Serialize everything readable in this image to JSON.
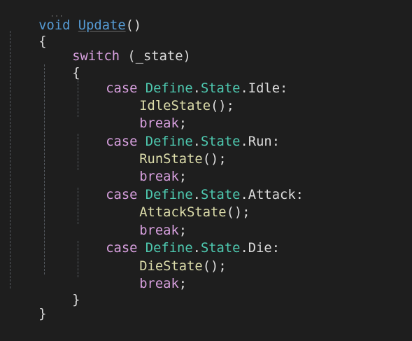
{
  "editor": {
    "lines": [
      [
        {
          "cls": "kw-blue",
          "text": "void"
        },
        {
          "cls": "punct",
          "text": " "
        },
        {
          "cls": "update-fn",
          "text": "Update"
        },
        {
          "cls": "punct",
          "text": "()"
        }
      ],
      [
        {
          "cls": "punct",
          "text": "{"
        }
      ],
      [
        {
          "cls": "kw-purple",
          "text": "switch"
        },
        {
          "cls": "punct",
          "text": " (_state)"
        }
      ],
      [
        {
          "cls": "punct",
          "text": "{"
        }
      ],
      [
        {
          "cls": "kw-purple",
          "text": "case"
        },
        {
          "cls": "punct",
          "text": " "
        },
        {
          "cls": "type",
          "text": "Define"
        },
        {
          "cls": "punct",
          "text": "."
        },
        {
          "cls": "type",
          "text": "State"
        },
        {
          "cls": "punct",
          "text": ".Idle:"
        }
      ],
      [
        {
          "cls": "method",
          "text": "IdleState"
        },
        {
          "cls": "punct",
          "text": "();"
        }
      ],
      [
        {
          "cls": "kw-purple",
          "text": "break"
        },
        {
          "cls": "punct",
          "text": ";"
        }
      ],
      [
        {
          "cls": "kw-purple",
          "text": "case"
        },
        {
          "cls": "punct",
          "text": " "
        },
        {
          "cls": "type",
          "text": "Define"
        },
        {
          "cls": "punct",
          "text": "."
        },
        {
          "cls": "type",
          "text": "State"
        },
        {
          "cls": "punct",
          "text": ".Run:"
        }
      ],
      [
        {
          "cls": "method",
          "text": "RunState"
        },
        {
          "cls": "punct",
          "text": "();"
        }
      ],
      [
        {
          "cls": "kw-purple",
          "text": "break"
        },
        {
          "cls": "punct",
          "text": ";"
        }
      ],
      [
        {
          "cls": "kw-purple",
          "text": "case"
        },
        {
          "cls": "punct",
          "text": " "
        },
        {
          "cls": "type",
          "text": "Define"
        },
        {
          "cls": "punct",
          "text": "."
        },
        {
          "cls": "type",
          "text": "State"
        },
        {
          "cls": "punct",
          "text": ".Attack:"
        }
      ],
      [
        {
          "cls": "method",
          "text": "AttackState"
        },
        {
          "cls": "punct",
          "text": "();"
        }
      ],
      [
        {
          "cls": "kw-purple",
          "text": "break"
        },
        {
          "cls": "punct",
          "text": ";"
        }
      ],
      [
        {
          "cls": "kw-purple",
          "text": "case"
        },
        {
          "cls": "punct",
          "text": " "
        },
        {
          "cls": "type",
          "text": "Define"
        },
        {
          "cls": "punct",
          "text": "."
        },
        {
          "cls": "type",
          "text": "State"
        },
        {
          "cls": "punct",
          "text": ".Die:"
        }
      ],
      [
        {
          "cls": "method",
          "text": "DieState"
        },
        {
          "cls": "punct",
          "text": "();"
        }
      ],
      [
        {
          "cls": "kw-purple",
          "text": "break"
        },
        {
          "cls": "punct",
          "text": ";"
        }
      ],
      [
        {
          "cls": "punct",
          "text": "}"
        }
      ],
      [
        {
          "cls": "punct",
          "text": "}"
        }
      ]
    ]
  },
  "theme": {
    "background": "#1e1e1e",
    "keyword_blue": "#569cd6",
    "keyword_purple": "#d8a0df",
    "type_teal": "#4ec9b0",
    "method_yellow": "#dcdcaa",
    "default_text": "#dcdcdc",
    "indent_guide": "#555a60"
  }
}
